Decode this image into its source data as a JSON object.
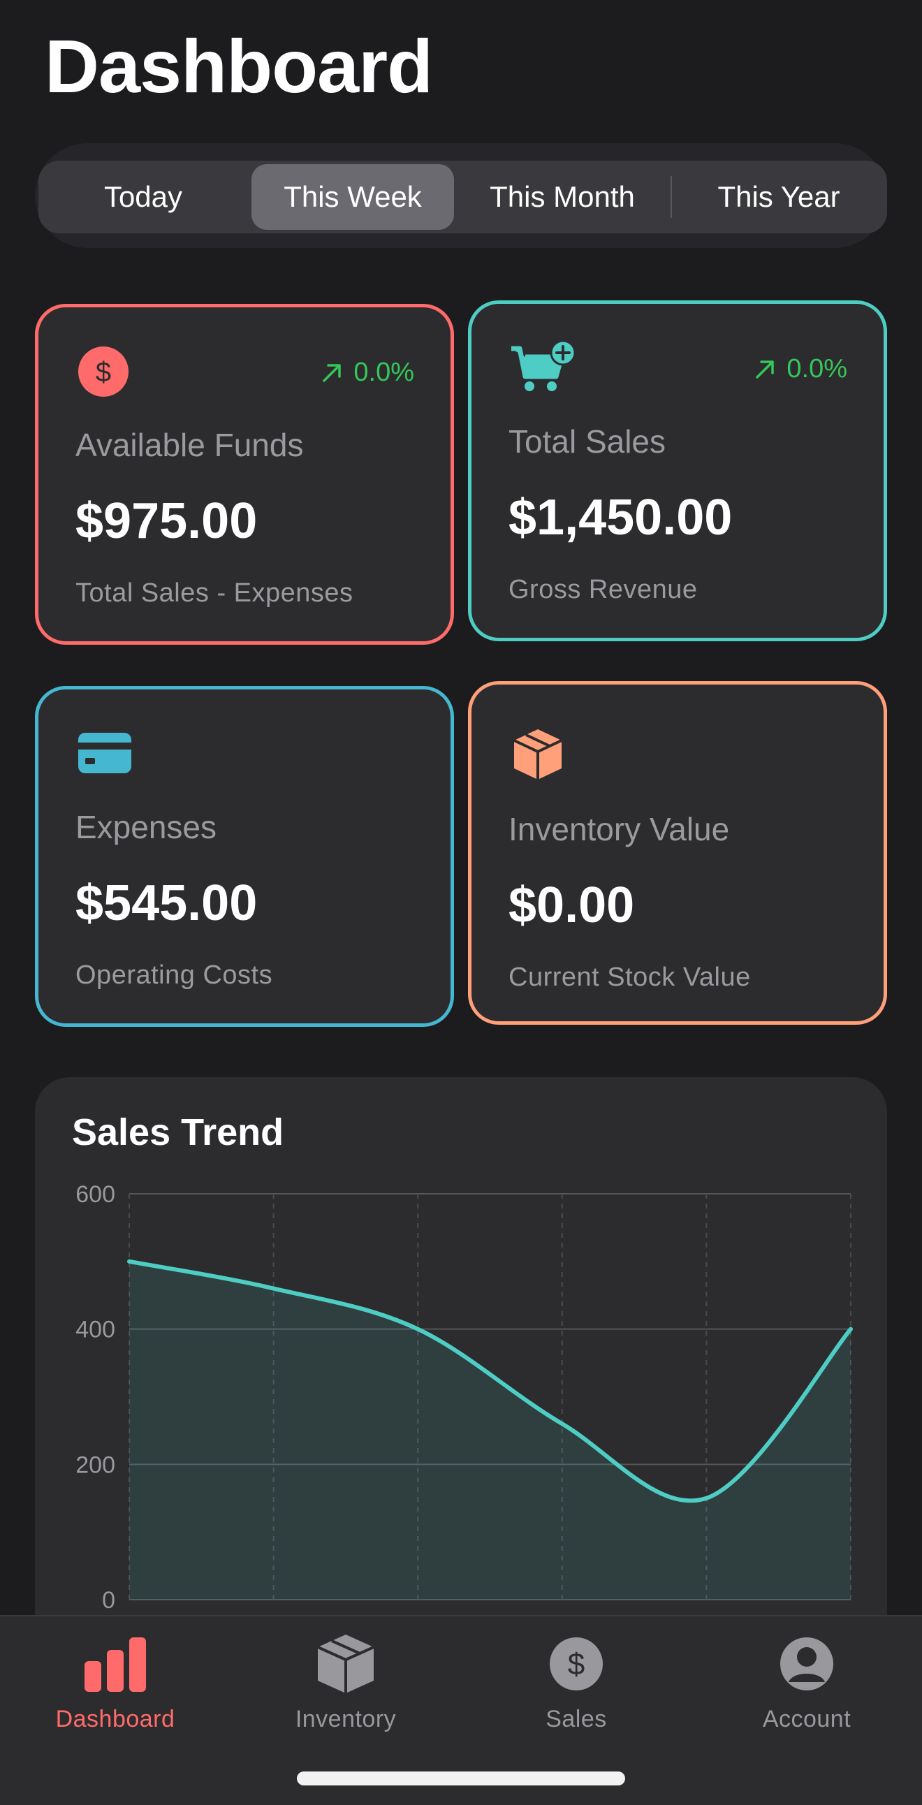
{
  "header": {
    "title": "Dashboard"
  },
  "period_selector": {
    "options": [
      "Today",
      "This Week",
      "This Month",
      "This Year"
    ],
    "selected": "This Week"
  },
  "cards": [
    {
      "label": "Available Funds",
      "value": "$975.00",
      "subtitle": "Total Sales - Expenses",
      "trend": "0.0%",
      "accent": "#ff6b6b",
      "icon": "dollar-circle-icon"
    },
    {
      "label": "Total Sales",
      "value": "$1,450.00",
      "subtitle": "Gross Revenue",
      "trend": "0.0%",
      "accent": "#4ecdc4",
      "icon": "cart-plus-icon"
    },
    {
      "label": "Expenses",
      "value": "$545.00",
      "subtitle": "Operating Costs",
      "accent": "#45b7d1",
      "icon": "credit-card-icon"
    },
    {
      "label": "Inventory Value",
      "value": "$0.00",
      "subtitle": "Current Stock Value",
      "accent": "#ffa07a",
      "icon": "box-icon"
    }
  ],
  "chart": {
    "title": "Sales Trend"
  },
  "chart_data": {
    "type": "area",
    "title": "Sales Trend",
    "y_ticks": [
      "0",
      "200",
      "400",
      "600"
    ],
    "ylim": [
      0,
      600
    ],
    "values": [
      500,
      460,
      400,
      260,
      150,
      400
    ],
    "grid": true,
    "line_color": "#4ecdc4"
  },
  "tabbar": {
    "items": [
      {
        "label": "Dashboard",
        "icon": "bar-chart-icon",
        "active": true
      },
      {
        "label": "Inventory",
        "icon": "box-icon",
        "active": false
      },
      {
        "label": "Sales",
        "icon": "dollar-circle-icon",
        "active": false
      },
      {
        "label": "Account",
        "icon": "person-circle-icon",
        "active": false
      }
    ]
  },
  "colors": {
    "accent_active": "#ff6b6b",
    "trend_up": "#34c759",
    "background": "#1c1c1e",
    "card": "#2c2c2e"
  }
}
